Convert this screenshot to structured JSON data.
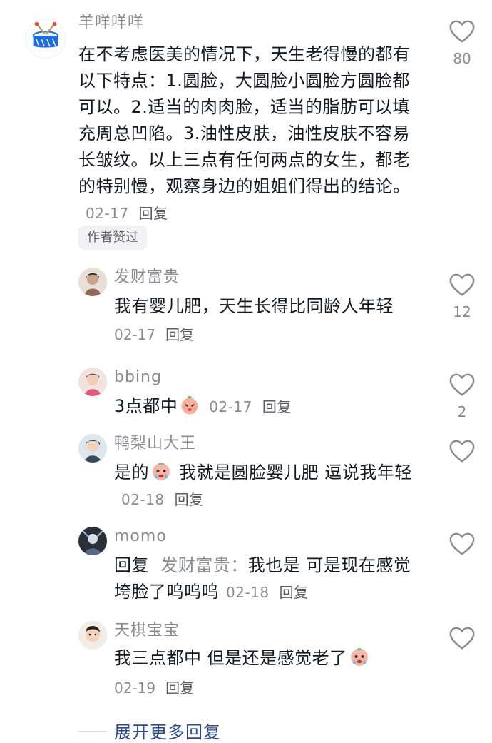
{
  "main_comment": {
    "username": "羊咩咩咩",
    "text": "在不考虑医美的情况下，天生老得慢的都有以下特点：1.圆脸，大圆脸小圆脸方圆脸都可以。2.适当的肉肉脸，适当的脂肪可以填充周总凹陷。3.油性皮肤，油性皮肤不容易长皱纹。以上三点有任何两点的女生，都老的特别慢，观察身边的姐姐们得出的结论。",
    "date": "02-17",
    "reply_label": "回复",
    "likes": "80",
    "author_badge": "作者赞过",
    "avatar_icon": "drum-icon"
  },
  "replies": [
    {
      "username": "发财富贵",
      "text": "我有婴儿肥，天生长得比同龄人年轻",
      "date": "02-17",
      "reply_label": "回复",
      "likes": "12"
    },
    {
      "username": "bbing",
      "text": "3点都中",
      "emoji": "peach-emoji",
      "date": "02-17",
      "reply_label": "回复",
      "likes": "2"
    },
    {
      "username": "鸭梨山大王",
      "text_before": "是的",
      "emoji": "crying-emoji",
      "text_after": " 我就是圆脸婴儿肥 逗说我年轻",
      "date": "02-18",
      "reply_label": "回复",
      "likes": ""
    },
    {
      "username": "momo",
      "reply_prefix": "回复",
      "reply_to": "发财富贵：",
      "text": "我也是 可是现在感觉垮脸了呜呜呜",
      "date": "02-18",
      "reply_label": "回复",
      "likes": ""
    },
    {
      "username": "天棋宝宝",
      "text": "我三点都中 但是还是感觉老了",
      "emoji": "crying-emoji",
      "date": "02-19",
      "reply_label": "回复",
      "likes": ""
    }
  ],
  "expand_more": "展开更多回复",
  "colors": {
    "text": "#161823",
    "muted": "#8a8b91",
    "link": "#2d4a8a",
    "badge_bg": "#f2f2f4"
  }
}
